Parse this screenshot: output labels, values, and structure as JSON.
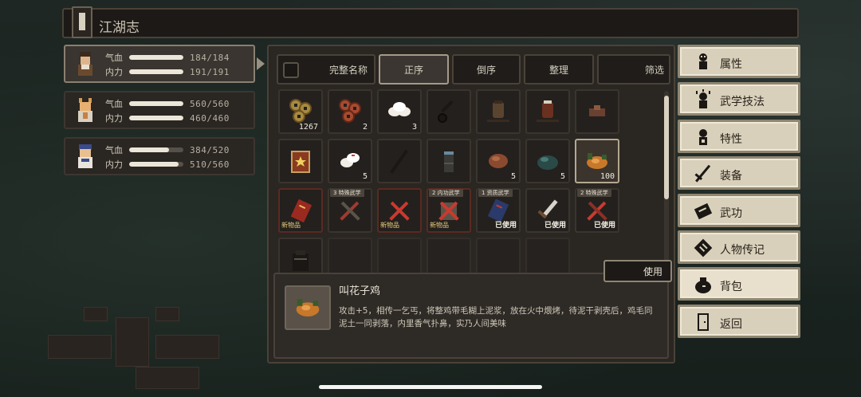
{
  "title": "江湖志",
  "characters": [
    {
      "hp_label": "气血",
      "hp": "184/184",
      "hp_frac": 1.0,
      "mp_label": "内力",
      "mp": "191/191",
      "mp_frac": 1.0
    },
    {
      "hp_label": "气血",
      "hp": "560/560",
      "hp_frac": 1.0,
      "mp_label": "内力",
      "mp": "460/460",
      "mp_frac": 1.0
    },
    {
      "hp_label": "气血",
      "hp": "384/520",
      "hp_frac": 0.74,
      "mp_label": "内力",
      "mp": "510/560",
      "mp_frac": 0.91
    }
  ],
  "tabs": {
    "full_name": "完整名称",
    "ascending": "正序",
    "descending": "倒序",
    "organize": "整理",
    "filter": "筛选"
  },
  "items_row1": [
    {
      "icon": "coin-icon",
      "count": "1267"
    },
    {
      "icon": "copper-coin-icon",
      "count": "2"
    },
    {
      "icon": "bun-icon",
      "count": "3"
    },
    {
      "icon": "key-icon",
      "count": ""
    },
    {
      "icon": "wine-jar-icon",
      "count": ""
    },
    {
      "icon": "wine-jar-red-icon",
      "count": ""
    },
    {
      "icon": "wood-block-icon",
      "count": ""
    }
  ],
  "items_row2": [
    {
      "icon": "scroll-book-icon",
      "count": ""
    },
    {
      "icon": "bun-icon",
      "count": "5"
    },
    {
      "icon": "spear-icon",
      "count": ""
    },
    {
      "icon": "bamboo-tube-icon",
      "count": ""
    },
    {
      "icon": "meat-icon",
      "count": "5"
    },
    {
      "icon": "stone-icon",
      "count": "5"
    },
    {
      "icon": "beggar-chicken-icon",
      "count": "100"
    }
  ],
  "items_row3": [
    {
      "icon": "red-book-icon",
      "tag": "",
      "new": "新物品",
      "used": ""
    },
    {
      "icon": "crossed-weapon-icon",
      "tag": "3 特殊武学",
      "new": "",
      "used": ""
    },
    {
      "icon": "crossed-weapon-red-icon",
      "tag": "",
      "new": "新物品",
      "used": ""
    },
    {
      "icon": "crossed-weapon-red-icon",
      "tag": "2 内功武学",
      "new": "新物品",
      "used": ""
    },
    {
      "icon": "blue-book-icon",
      "tag": "1 资质武学",
      "new": "",
      "used": "已使用"
    },
    {
      "icon": "sword-icon",
      "tag": "",
      "new": "",
      "used": "已使用"
    },
    {
      "icon": "crossed-weapon-red-icon",
      "tag": "2 特殊武学",
      "new": "",
      "used": "已使用"
    }
  ],
  "items_row4": [
    {
      "icon": "armor-icon"
    }
  ],
  "use_button": "使用",
  "selected_item": {
    "name": "叫花子鸡",
    "description": "攻击+5，相传一乞丐，将整鸡带毛糊上泥浆，放在火中煨烤，待泥干剥壳后，鸡毛同泥土一同剥落，内里香气扑鼻，实乃人间美味"
  },
  "menu": [
    {
      "icon": "figure-icon",
      "label": "属性"
    },
    {
      "icon": "figure-skill-icon",
      "label": "武学技法"
    },
    {
      "icon": "figure-trait-icon",
      "label": "特性"
    },
    {
      "icon": "sword-equip-icon",
      "label": "装备"
    },
    {
      "icon": "martial-book-icon",
      "label": "武功"
    },
    {
      "icon": "biography-icon",
      "label": "人物传记"
    },
    {
      "icon": "bag-icon",
      "label": "背包"
    },
    {
      "icon": "door-icon",
      "label": "返回"
    }
  ]
}
